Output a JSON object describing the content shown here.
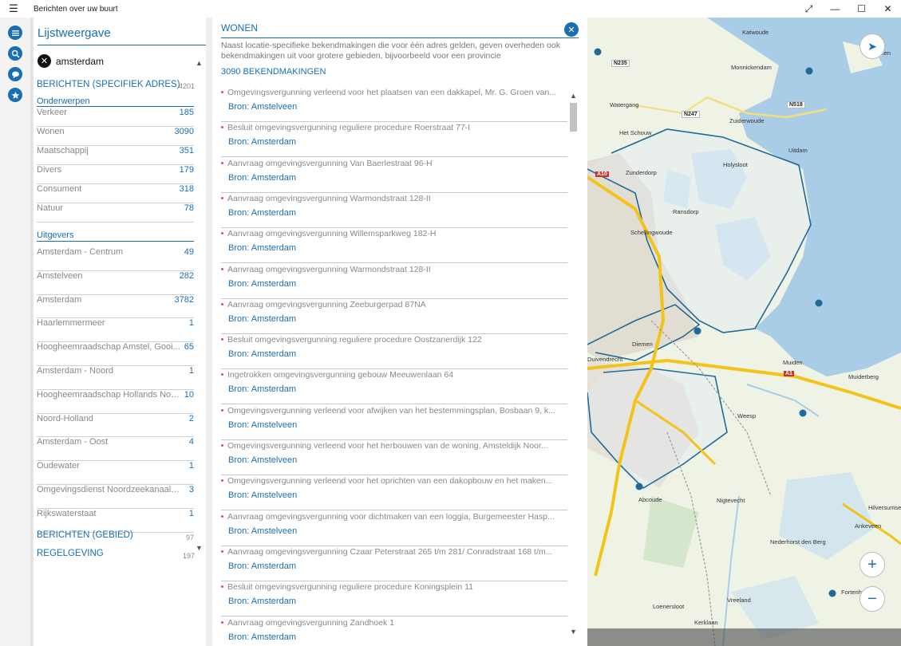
{
  "window": {
    "title": "Berichten over uw buurt",
    "menu_icon": "hamburger-icon",
    "controls": [
      "expand-icon",
      "minimize-icon",
      "maximize-icon",
      "close-icon"
    ]
  },
  "rail": {
    "items": [
      {
        "name": "list-icon"
      },
      {
        "name": "search-icon"
      },
      {
        "name": "chat-icon"
      },
      {
        "name": "star-icon"
      }
    ]
  },
  "list_panel": {
    "title": "Lijstweergave",
    "search_chip": "amsterdam",
    "section_specifiek": {
      "label": "BERICHTEN (SPECIFIEK ADRES)",
      "count": "4201"
    },
    "onderwerpen": {
      "label": "Onderwerpen",
      "items": [
        {
          "label": "Verkeer",
          "count": "185"
        },
        {
          "label": "Wonen",
          "count": "3090"
        },
        {
          "label": "Maatschappij",
          "count": "351"
        },
        {
          "label": "Divers",
          "count": "179"
        },
        {
          "label": "Consument",
          "count": "318"
        },
        {
          "label": "Natuur",
          "count": "78"
        }
      ]
    },
    "uitgevers": {
      "label": "Uitgevers",
      "items": [
        {
          "label": "Amsterdam - Centrum",
          "count": "49"
        },
        {
          "label": "Amstelveen",
          "count": "282"
        },
        {
          "label": "Amsterdam",
          "count": "3782"
        },
        {
          "label": "Haarlemmermeer",
          "count": "1"
        },
        {
          "label": "Hoogheemraadschap Amstel, Gooi...",
          "count": "65"
        },
        {
          "label": "Amsterdam - Noord",
          "count": "1"
        },
        {
          "label": "Hoogheemraadschap Hollands Noor...",
          "count": "10"
        },
        {
          "label": "Noord-Holland",
          "count": "2"
        },
        {
          "label": "Amsterdam - Oost",
          "count": "4"
        },
        {
          "label": "Oudewater",
          "count": "1"
        },
        {
          "label": "Omgevingsdienst Noordzeekanaalge...",
          "count": "3"
        },
        {
          "label": "Rijkswaterstaat",
          "count": "1"
        }
      ]
    },
    "section_gebied": {
      "label": "BERICHTEN (GEBIED)",
      "count": "97"
    },
    "section_regelgeving": {
      "label": "REGELGEVING",
      "count": "197"
    }
  },
  "results": {
    "title": "WONEN",
    "description": "Naast locatie-specifieke bekendmakingen die voor één adres gelden, geven overheden ook bekendmakingen uit voor grotere gebieden, bijvoorbeeld voor een provincie",
    "count_label": "3090 BEKENDMAKINGEN",
    "items": [
      {
        "title": "Omgevingsvergunning verleend voor het plaatsen van een dakkapel, Mr. G. Groen van...",
        "source": "Bron: Amstelveen"
      },
      {
        "title": "Besluit omgevingsvergunning reguliere procedure Roerstraat 77-I",
        "source": "Bron: Amsterdam"
      },
      {
        "title": "Aanvraag omgevingsvergunning Van Baerlestraat 96-H",
        "source": "Bron: Amsterdam"
      },
      {
        "title": "Aanvraag omgevingsvergunning Warmondstraat 128-II",
        "source": "Bron: Amsterdam"
      },
      {
        "title": "Aanvraag omgevingsvergunning Willemsparkweg 182-H",
        "source": "Bron: Amsterdam"
      },
      {
        "title": "Aanvraag omgevingsvergunning Warmondstraat 128-II",
        "source": "Bron: Amsterdam"
      },
      {
        "title": "Aanvraag omgevingsvergunning Zeeburgerpad 87NA",
        "source": "Bron: Amsterdam"
      },
      {
        "title": "Besluit omgevingsvergunning reguliere procedure Oostzanerdijk 122",
        "source": "Bron: Amsterdam"
      },
      {
        "title": "Ingetrokken omgevingsvergunning gebouw Meeuwenlaan 64",
        "source": "Bron: Amsterdam"
      },
      {
        "title": "Omgevingsvergunning verleend voor afwijken van het bestemmingsplan, Bosbaan 9, k...",
        "source": "Bron: Amstelveen"
      },
      {
        "title": "Omgevingsvergunning verleend voor het herbouwen van de woning, Amsteldijk Noor...",
        "source": "Bron: Amstelveen"
      },
      {
        "title": "Omgevingsvergunning verleend voor het oprichten van een dakopbouw en het maken...",
        "source": "Bron: Amstelveen"
      },
      {
        "title": "Aanvraag omgevingsvergunning voor dichtmaken van een loggia, Burgemeester Hasp...",
        "source": "Bron: Amstelveen"
      },
      {
        "title": "Aanvraag omgevingsvergunning Czaar Peterstraat 265 t/m 281/ Conradstraat 168 t/m...",
        "source": "Bron: Amsterdam"
      },
      {
        "title": "Besluit omgevingsvergunning reguliere procedure Koningsplein 11",
        "source": "Bron: Amsterdam"
      },
      {
        "title": "Aanvraag omgevingsvergunning Zandhoek 1",
        "source": "Bron: Amsterdam"
      }
    ]
  },
  "map": {
    "places": [
      "Katwoude",
      "Marken",
      "Monnickendam",
      "Watergang",
      "Het Schouw",
      "Zuiderwoude",
      "Uitdam",
      "Holysloot",
      "Zunderdorp",
      "Ransdorp",
      "Schellingwoude",
      "Diemen",
      "Duivendrecht",
      "Muiden",
      "Muiderberg",
      "Weesp",
      "Abcoude",
      "Nigtevecht",
      "Hilversumse",
      "Ankeveen",
      "Nederhorst den Berg",
      "Loenersloot",
      "Vreeland",
      "Kerklaan",
      "Fortenhoe"
    ],
    "roads": [
      "N235",
      "N247",
      "N518",
      "A10",
      "A1"
    ],
    "zoom_in": "+",
    "zoom_out": "−",
    "colors": {
      "water": "#a9cde7",
      "land": "#eef3e6",
      "boundary": "#1f6a96",
      "highway": "#f2c318"
    }
  }
}
